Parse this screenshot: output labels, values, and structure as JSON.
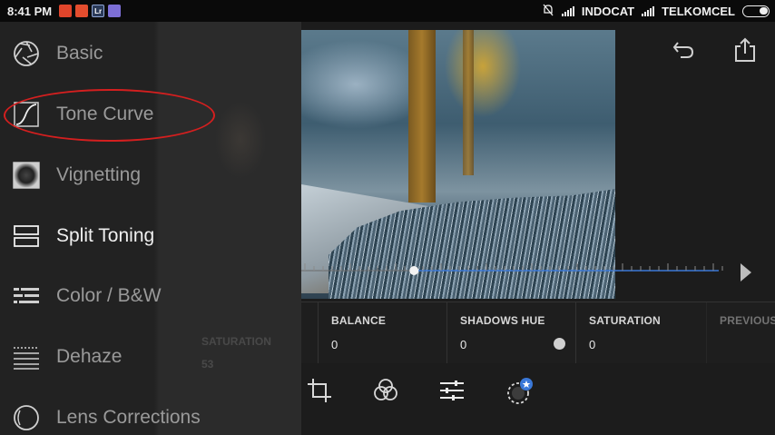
{
  "status_bar": {
    "time": "8:41 PM",
    "carrier1": "INDOCAT",
    "carrier2": "TELKOMCEL",
    "notif_icons": [
      "youtube-icon",
      "flash-icon",
      "lightroom-icon",
      "app-icon"
    ],
    "notif_colors": [
      "#e0452b",
      "#e44d2e",
      "#2b3a58",
      "#7d6fd6"
    ],
    "notif_texts": [
      "",
      "",
      "Lr",
      ""
    ]
  },
  "drawer": {
    "items": [
      {
        "label": "Basic",
        "icon": "aperture-icon"
      },
      {
        "label": "Tone Curve",
        "icon": "curve-icon"
      },
      {
        "label": "Vignetting",
        "icon": "vignette-icon"
      },
      {
        "label": "Split Toning",
        "icon": "split-toning-icon"
      },
      {
        "label": "Color / B&W",
        "icon": "color-bw-icon"
      },
      {
        "label": "Dehaze",
        "icon": "dehaze-icon"
      },
      {
        "label": "Lens Corrections",
        "icon": "lens-icon"
      }
    ],
    "active_index": 3,
    "annotated_index": 1,
    "annotation_color": "#d41f1f"
  },
  "params": {
    "items": [
      {
        "label": "BALANCE",
        "value": "0"
      },
      {
        "label": "SHADOWS HUE",
        "value": "0"
      },
      {
        "label": "SATURATION",
        "value": "0"
      },
      {
        "label": "PREVIOUS",
        "value": ""
      }
    ]
  },
  "slider": {
    "value": 0.27,
    "accent": "#3a78d8"
  },
  "toolbar": {
    "tools": [
      "crop-icon",
      "presets-icon",
      "adjust-icon",
      "selective-icon"
    ],
    "badge_color": "#3a78d8"
  }
}
